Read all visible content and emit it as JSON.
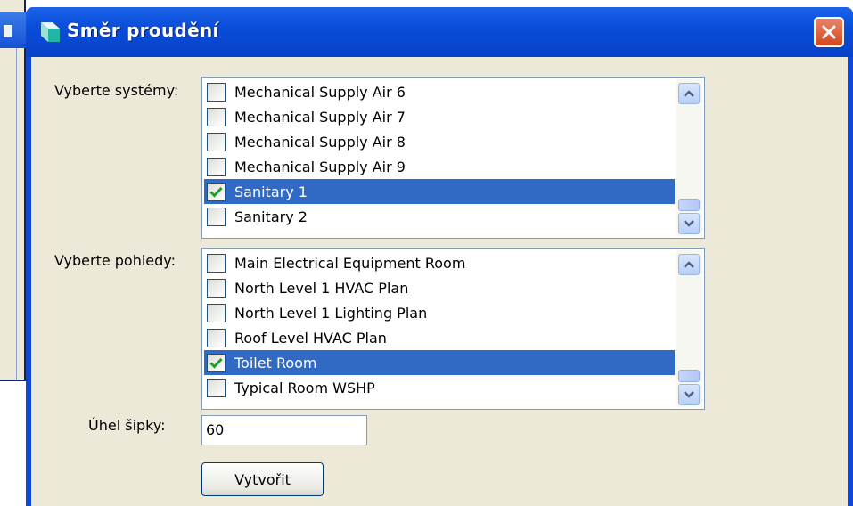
{
  "dialog": {
    "title": "Směr proudění",
    "close_label": "×"
  },
  "systems": {
    "label": "Vyberte systémy:",
    "items": [
      {
        "label": "Mechanical Supply Air 6",
        "checked": false,
        "selected": false
      },
      {
        "label": "Mechanical Supply Air 7",
        "checked": false,
        "selected": false
      },
      {
        "label": "Mechanical Supply Air 8",
        "checked": false,
        "selected": false
      },
      {
        "label": "Mechanical Supply Air 9",
        "checked": false,
        "selected": false
      },
      {
        "label": "Sanitary 1",
        "checked": true,
        "selected": true
      },
      {
        "label": "Sanitary 2",
        "checked": false,
        "selected": false
      }
    ]
  },
  "views": {
    "label": "Vyberte pohledy:",
    "items": [
      {
        "label": "Main Electrical Equipment Room",
        "checked": false,
        "selected": false
      },
      {
        "label": "North Level 1 HVAC Plan",
        "checked": false,
        "selected": false
      },
      {
        "label": "North Level 1 Lighting Plan",
        "checked": false,
        "selected": false
      },
      {
        "label": "Roof Level HVAC Plan",
        "checked": false,
        "selected": false
      },
      {
        "label": "Toilet Room",
        "checked": true,
        "selected": true
      },
      {
        "label": "Typical Room WSHP",
        "checked": false,
        "selected": false
      }
    ]
  },
  "arrow_angle": {
    "label": "Úhel šipky:",
    "value": "60"
  },
  "create_button": {
    "label": "Vytvořit"
  },
  "colors": {
    "titlebar": "#0a4dd9",
    "selection": "#316ac5",
    "check": "#21a121",
    "close": "#d4471c"
  }
}
